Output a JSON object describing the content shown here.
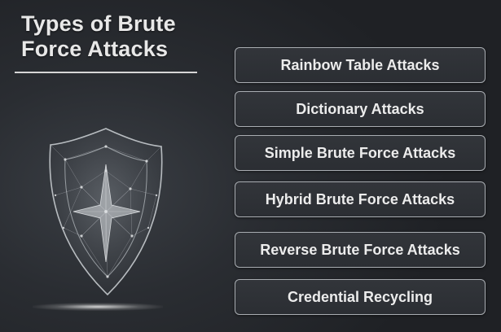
{
  "title": {
    "line1": "Types of Brute",
    "line2": "Force Attacks"
  },
  "items": [
    {
      "label": "Rainbow Table Attacks"
    },
    {
      "label": "Dictionary Attacks"
    },
    {
      "label": "Simple Brute Force Attacks"
    },
    {
      "label": "Hybrid Brute Force Attacks"
    },
    {
      "label": "Reverse Brute Force Attacks"
    },
    {
      "label": "Credential Recycling"
    }
  ],
  "colors": {
    "background": "#2a2d32",
    "box_border": "#a9adb2",
    "text": "#ececec"
  },
  "icons": {
    "shield": "shield-icon"
  }
}
